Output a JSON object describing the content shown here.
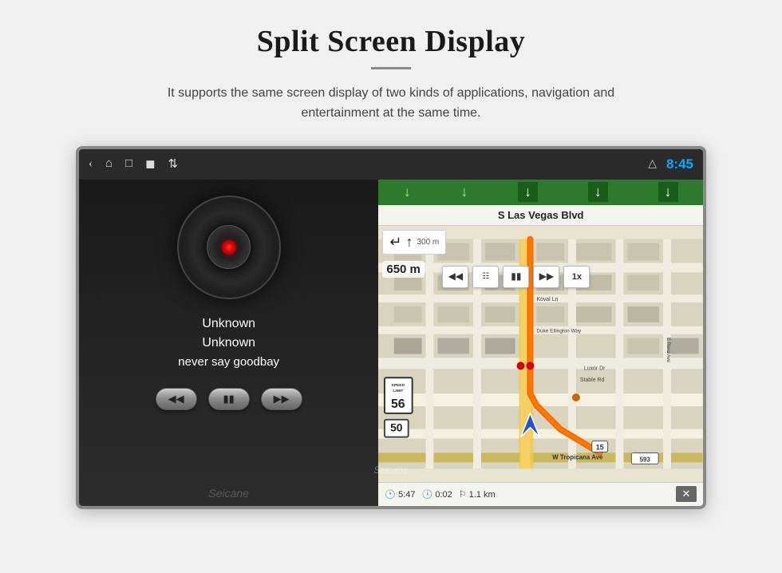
{
  "page": {
    "title": "Split Screen Display",
    "divider": "—",
    "subtitle": "It supports the same screen display of two kinds of applications, navigation and entertainment at the same time."
  },
  "status_bar": {
    "time": "8:45",
    "icons": [
      "back-arrow",
      "home",
      "window",
      "image",
      "usb"
    ]
  },
  "media": {
    "artist": "Unknown",
    "album": "Unknown",
    "song_title": "never say goodbay",
    "controls": {
      "prev": "⏮",
      "play_pause": "⏸",
      "next": "⏭"
    },
    "watermark": "Seicane"
  },
  "navigation": {
    "street": "S Las Vegas Blvd",
    "turn_distance": "300 m",
    "dist_to_next": "650 m",
    "speed_limit": "56",
    "speed_current": "50",
    "route_marker": "15",
    "street_labels": [
      "Koval Ln",
      "Duke Ellington Way",
      "Luxor Dr",
      "Stable Rd",
      "W Tropicana Ave"
    ],
    "bottom_bar": {
      "time": "5:47",
      "elapsed": "0:02",
      "distance": "1.1 km"
    },
    "controls": [
      "⏮",
      "≡",
      "⏸",
      "⏭",
      "1x"
    ]
  }
}
